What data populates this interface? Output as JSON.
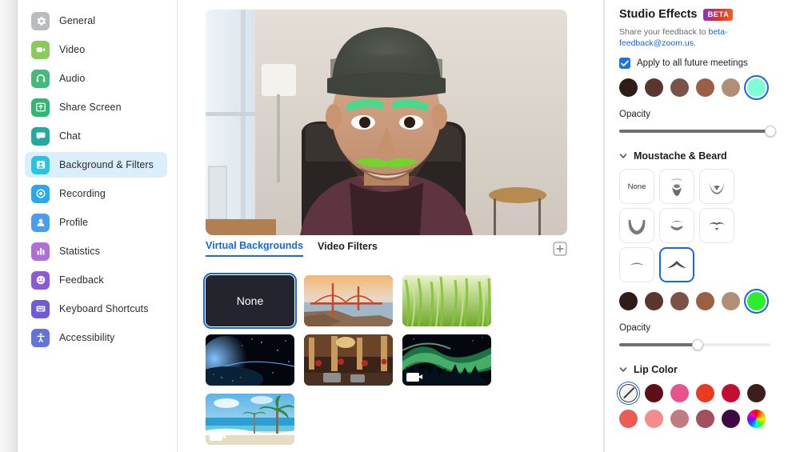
{
  "sidebar": {
    "items": [
      {
        "label": "General",
        "icon": "gear-icon",
        "color": "#b9bcbe",
        "active": false
      },
      {
        "label": "Video",
        "icon": "video-icon",
        "color": "#8bc95d",
        "active": false
      },
      {
        "label": "Audio",
        "icon": "headset-icon",
        "color": "#44b97b",
        "active": false
      },
      {
        "label": "Share Screen",
        "icon": "share-icon",
        "color": "#2eb872",
        "active": false
      },
      {
        "label": "Chat",
        "icon": "chat-icon",
        "color": "#23a9a0",
        "active": false
      },
      {
        "label": "Background & Filters",
        "icon": "portrait-icon",
        "color": "#28c4e3",
        "active": true
      },
      {
        "label": "Recording",
        "icon": "record-icon",
        "color": "#27a8f0",
        "active": false
      },
      {
        "label": "Profile",
        "icon": "person-icon",
        "color": "#4a9ef0",
        "active": false
      },
      {
        "label": "Statistics",
        "icon": "bar-chart-icon",
        "color": "#b06fd6",
        "active": false
      },
      {
        "label": "Feedback",
        "icon": "smiley-icon",
        "color": "#8a5ad8",
        "active": false
      },
      {
        "label": "Keyboard Shortcuts",
        "icon": "keyboard-icon",
        "color": "#6f5ada",
        "active": false
      },
      {
        "label": "Accessibility",
        "icon": "accessibility-icon",
        "color": "#6374d8",
        "active": false
      }
    ]
  },
  "center": {
    "tabs": [
      {
        "label": "Virtual Backgrounds",
        "active": true
      },
      {
        "label": "Video Filters",
        "active": false
      }
    ],
    "add_button": "plus-icon",
    "backgrounds": [
      {
        "name": "None",
        "type": "none",
        "selected": true,
        "video": false
      },
      {
        "name": "Golden Gate Bridge",
        "type": "bridge",
        "selected": false,
        "video": false
      },
      {
        "name": "Grass",
        "type": "grass",
        "selected": false,
        "video": false
      },
      {
        "name": "Earth from Space",
        "type": "space",
        "selected": false,
        "video": false
      },
      {
        "name": "Hotel Lobby",
        "type": "lobby",
        "selected": false,
        "video": false
      },
      {
        "name": "Aurora Borealis",
        "type": "aurora",
        "selected": false,
        "video": true
      },
      {
        "name": "Beach",
        "type": "beach",
        "selected": false,
        "video": true
      }
    ]
  },
  "studio": {
    "title": "Studio Effects",
    "badge": "BETA",
    "feedback_prefix": "Share your feedback to ",
    "feedback_link": "beta-feedback@zoom.us",
    "feedback_suffix": ".",
    "apply_all_label": "Apply to all future meetings",
    "apply_all_checked": true,
    "eyebrow": {
      "colors": [
        "#2e1c17",
        "#5b362c",
        "#7a5246",
        "#9b5f45",
        "#b18f74",
        "#7effd4"
      ],
      "selected_index": 5,
      "opacity_label": "Opacity",
      "opacity_value": 100
    },
    "moustache": {
      "section_label": "Moustache & Beard",
      "expanded": true,
      "styles": [
        {
          "name": "None",
          "kind": "none"
        },
        {
          "name": "Full Beard",
          "kind": "full-beard"
        },
        {
          "name": "Goatee Circle",
          "kind": "goatee-circle"
        },
        {
          "name": "Chin Strap",
          "kind": "chin-strap"
        },
        {
          "name": "Soul Patch Arc",
          "kind": "soul-arc"
        },
        {
          "name": "Handlebar",
          "kind": "handlebar"
        },
        {
          "name": "Thin Moustache",
          "kind": "thin"
        },
        {
          "name": "Chevron",
          "kind": "chevron"
        }
      ],
      "selected_index": 7,
      "colors": [
        "#2e1c17",
        "#5b362c",
        "#7a5246",
        "#9b5f45",
        "#b18f74",
        "#2aef2a"
      ],
      "selected_color_index": 5,
      "opacity_label": "Opacity",
      "opacity_value": 52
    },
    "lip": {
      "section_label": "Lip Color",
      "expanded": true,
      "colors": [
        {
          "name": "None",
          "hex": "none"
        },
        {
          "name": "Maroon",
          "hex": "#5e0f17"
        },
        {
          "name": "Pink",
          "hex": "#e6548f"
        },
        {
          "name": "Red",
          "hex": "#ea3a22"
        },
        {
          "name": "Crimson",
          "hex": "#c40e30"
        },
        {
          "name": "Dark Plum",
          "hex": "#3c1e1e"
        },
        {
          "name": "Coral",
          "hex": "#ec5c55"
        },
        {
          "name": "Salmon",
          "hex": "#f38d8d"
        },
        {
          "name": "Rose",
          "hex": "#bf7c82"
        },
        {
          "name": "Berry",
          "hex": "#a2505c"
        },
        {
          "name": "Eggplant",
          "hex": "#3d0b42"
        },
        {
          "name": "Custom",
          "hex": "rainbow"
        }
      ],
      "selected_index": 0
    }
  },
  "colors": {
    "accent": "#1767e0",
    "active_nav_bg": "#daeefb"
  }
}
